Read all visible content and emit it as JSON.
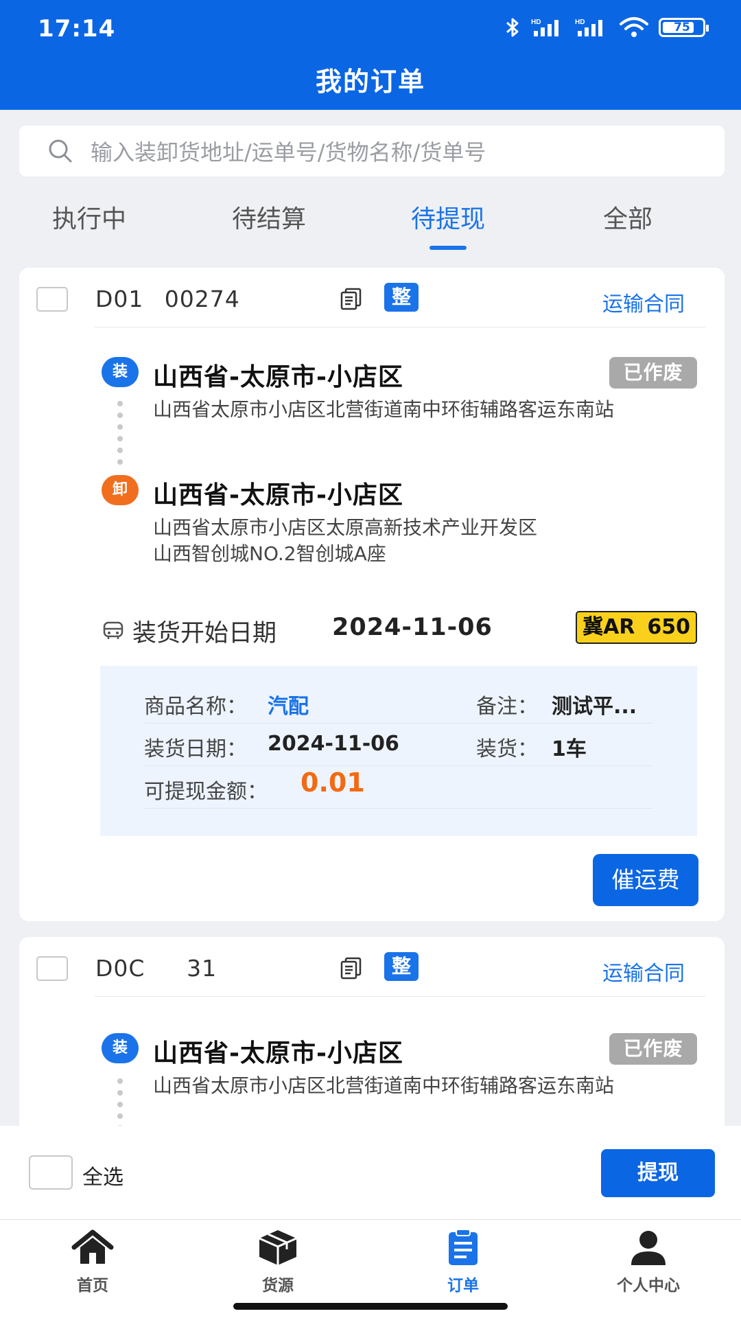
{
  "status_bar": {
    "time": "17:14",
    "battery": "75",
    "network_1": "HD",
    "network_2": "HD"
  },
  "header": {
    "title": "我的订单"
  },
  "search": {
    "placeholder": "输入装卸货地址/运单号/货物名称/货单号"
  },
  "tabs": [
    {
      "label": "执行中"
    },
    {
      "label": "待结算"
    },
    {
      "label": "待提现",
      "active": true
    },
    {
      "label": "全部"
    }
  ],
  "orders": [
    {
      "order_no": "D01    00274",
      "badge": "整",
      "contract_label": "运输合同",
      "status": "已作废",
      "load": {
        "pin": "装",
        "title": "山西省-太原市-小店区",
        "address": "山西省太原市小店区北营街道南中环街辅路客运东南站"
      },
      "unload": {
        "pin": "卸",
        "title": "山西省-太原市-小店区",
        "address_line1": "山西省太原市小店区太原高新技术产业开发区",
        "address_line2": "山西智创城NO.2智创城A座"
      },
      "date_label": "装货开始日期",
      "date_value": "2024-11-06",
      "plate": "冀AR   650",
      "info": {
        "goods_label": "商品名称：",
        "goods_value": "汽配",
        "remark_label": "备注：",
        "remark_value": "测试平...",
        "load_date_label": "装货日期：",
        "load_date_value": "2024-11-06",
        "load_count_label": "装货：",
        "load_count_value": "1车",
        "amount_label": "可提现金额：",
        "amount_value": "0.01"
      },
      "action_label": "催运费"
    },
    {
      "order_no": "D0C        31",
      "badge": "整",
      "contract_label": "运输合同",
      "status": "已作废",
      "load": {
        "pin": "装",
        "title": "山西省-太原市-小店区",
        "address": "山西省太原市小店区北营街道南中环街辅路客运东南站"
      }
    }
  ],
  "action_bar": {
    "select_all_label": "全选",
    "withdraw_label": "提现"
  },
  "bottom_nav": [
    {
      "label": "首页",
      "icon": "home-icon"
    },
    {
      "label": "货源",
      "icon": "box-icon"
    },
    {
      "label": "订单",
      "icon": "order-icon",
      "active": true
    },
    {
      "label": "个人中心",
      "icon": "person-icon"
    }
  ],
  "colors": {
    "brand": "#0b66e4",
    "accent": "#1a73e8",
    "amount": "#f26a12",
    "unload_pin": "#f06e1e",
    "status_void": "#a9a9a9",
    "plate": "#f9d11c"
  }
}
